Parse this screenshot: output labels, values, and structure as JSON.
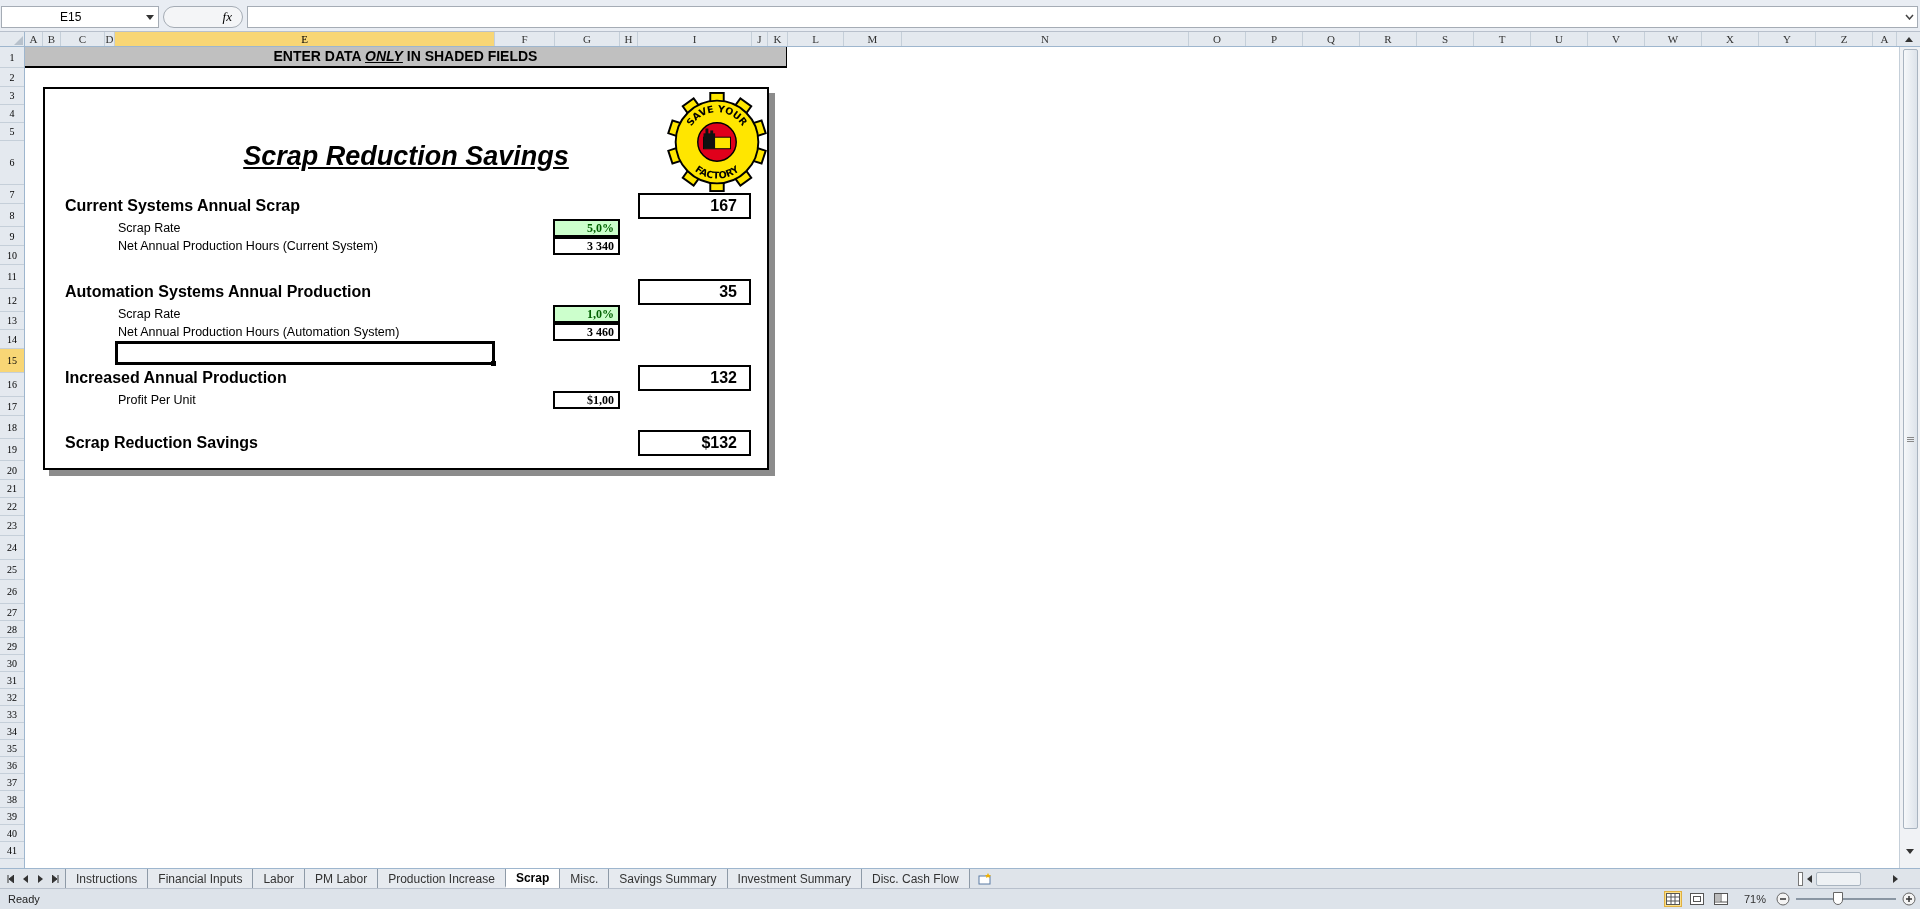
{
  "formula_bar": {
    "name_box": "E15",
    "function_label": "fx"
  },
  "columns": [
    {
      "label": "A",
      "selected": false
    },
    {
      "label": "B",
      "selected": false
    },
    {
      "label": "C",
      "selected": false
    },
    {
      "label": "D",
      "selected": false
    },
    {
      "label": "E",
      "selected": true
    },
    {
      "label": "F",
      "selected": false
    },
    {
      "label": "G",
      "selected": false
    },
    {
      "label": "H",
      "selected": false
    },
    {
      "label": "I",
      "selected": false
    },
    {
      "label": "J",
      "selected": false
    },
    {
      "label": "K",
      "selected": false
    },
    {
      "label": "L",
      "selected": false
    },
    {
      "label": "M",
      "selected": false
    },
    {
      "label": "N",
      "selected": false
    },
    {
      "label": "O",
      "selected": false
    },
    {
      "label": "P",
      "selected": false
    },
    {
      "label": "Q",
      "selected": false
    },
    {
      "label": "R",
      "selected": false
    },
    {
      "label": "S",
      "selected": false
    },
    {
      "label": "T",
      "selected": false
    },
    {
      "label": "U",
      "selected": false
    },
    {
      "label": "V",
      "selected": false
    },
    {
      "label": "W",
      "selected": false
    },
    {
      "label": "X",
      "selected": false
    },
    {
      "label": "Y",
      "selected": false
    },
    {
      "label": "Z",
      "selected": false
    },
    {
      "label": "A",
      "selected": false
    }
  ],
  "rows": [
    {
      "label": "1",
      "selected": false
    },
    {
      "label": "2",
      "selected": false
    },
    {
      "label": "3",
      "selected": false
    },
    {
      "label": "4",
      "selected": false
    },
    {
      "label": "5",
      "selected": false
    },
    {
      "label": "6",
      "selected": false
    },
    {
      "label": "7",
      "selected": false
    },
    {
      "label": "8",
      "selected": false
    },
    {
      "label": "9",
      "selected": false
    },
    {
      "label": "10",
      "selected": false
    },
    {
      "label": "11",
      "selected": false
    },
    {
      "label": "12",
      "selected": false
    },
    {
      "label": "13",
      "selected": false
    },
    {
      "label": "14",
      "selected": false
    },
    {
      "label": "15",
      "selected": true
    },
    {
      "label": "16",
      "selected": false
    },
    {
      "label": "17",
      "selected": false
    },
    {
      "label": "18",
      "selected": false
    },
    {
      "label": "19",
      "selected": false
    },
    {
      "label": "20",
      "selected": false
    },
    {
      "label": "21",
      "selected": false
    },
    {
      "label": "22",
      "selected": false
    },
    {
      "label": "23",
      "selected": false
    },
    {
      "label": "24",
      "selected": false
    },
    {
      "label": "25",
      "selected": false
    },
    {
      "label": "26",
      "selected": false
    },
    {
      "label": "27",
      "selected": false
    },
    {
      "label": "28",
      "selected": false
    },
    {
      "label": "29",
      "selected": false
    },
    {
      "label": "30",
      "selected": false
    },
    {
      "label": "31",
      "selected": false
    },
    {
      "label": "32",
      "selected": false
    },
    {
      "label": "33",
      "selected": false
    },
    {
      "label": "34",
      "selected": false
    },
    {
      "label": "35",
      "selected": false
    },
    {
      "label": "36",
      "selected": false
    },
    {
      "label": "37",
      "selected": false
    },
    {
      "label": "38",
      "selected": false
    },
    {
      "label": "39",
      "selected": false
    },
    {
      "label": "40",
      "selected": false
    },
    {
      "label": "41",
      "selected": false
    }
  ],
  "banner": {
    "before": "ENTER DATA",
    "emphasis": "ONLY",
    "after": "IN SHADED FIELDS"
  },
  "card": {
    "title": "Scrap Reduction Savings",
    "logo": {
      "top_text": "SAVE YOUR",
      "bottom_text": "FACTORY"
    },
    "lines": [
      {
        "kind": "heading",
        "label": "Current Systems Annual Scrap",
        "value": "167"
      },
      {
        "kind": "input",
        "label": "Scrap Rate",
        "value": "5,0%",
        "shaded": true
      },
      {
        "kind": "input",
        "label": "Net Annual Production Hours (Current System)",
        "value": "3 340",
        "shaded": false
      },
      {
        "kind": "heading",
        "label": "Automation Systems Annual Production",
        "value": "35"
      },
      {
        "kind": "input",
        "label": "Scrap Rate",
        "value": "1,0%",
        "shaded": true
      },
      {
        "kind": "input",
        "label": "Net Annual Production Hours (Automation System)",
        "value": "3 460",
        "shaded": false
      },
      {
        "kind": "cell",
        "selected": true
      },
      {
        "kind": "heading",
        "label": "Increased Annual Production",
        "value": "132"
      },
      {
        "kind": "input",
        "label": "Profit Per Unit",
        "value": "$1,00",
        "shaded": false
      },
      {
        "kind": "heading",
        "label": "Scrap Reduction Savings",
        "value": "$132"
      }
    ]
  },
  "sheet_tabs": [
    {
      "label": "Instructions",
      "selected": false
    },
    {
      "label": "Financial Inputs",
      "selected": false
    },
    {
      "label": "Labor",
      "selected": false
    },
    {
      "label": "PM Labor",
      "selected": false
    },
    {
      "label": "Production Increase",
      "selected": false
    },
    {
      "label": "Scrap",
      "selected": true
    },
    {
      "label": "Misc.",
      "selected": false
    },
    {
      "label": "Savings Summary",
      "selected": false
    },
    {
      "label": "Investment Summary",
      "selected": false
    },
    {
      "label": "Disc. Cash Flow",
      "selected": false
    }
  ],
  "status_bar": {
    "status": "Ready",
    "views": [
      {
        "kind": "normal",
        "selected": true
      },
      {
        "kind": "layout",
        "selected": false
      },
      {
        "kind": "break",
        "selected": false
      }
    ],
    "zoom": {
      "reading": "71%",
      "level": 0.42
    }
  }
}
